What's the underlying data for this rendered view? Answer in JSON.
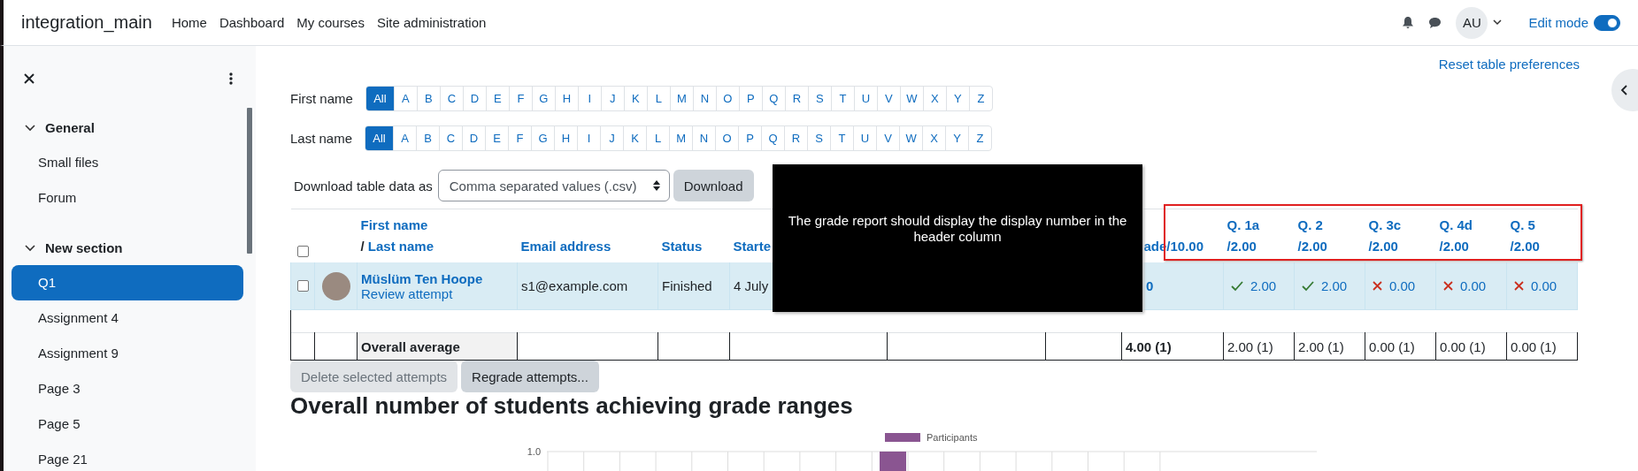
{
  "navbar": {
    "site_name": "integration_main",
    "links": [
      "Home",
      "Dashboard",
      "My courses",
      "Site administration"
    ],
    "avatar": "AU",
    "edit_mode": {
      "label": "Edit mode",
      "on": true
    }
  },
  "sidebar": {
    "sections": [
      {
        "title": "General",
        "expanded": true,
        "items": [
          {
            "label": "Small files",
            "selected": false
          },
          {
            "label": "Forum",
            "selected": false
          }
        ]
      },
      {
        "title": "New section",
        "expanded": true,
        "items": [
          {
            "label": "Q1",
            "selected": true
          },
          {
            "label": "Assignment 4",
            "selected": false
          },
          {
            "label": "Assignment 9",
            "selected": false
          },
          {
            "label": "Page 3",
            "selected": false
          },
          {
            "label": "Page 5",
            "selected": false
          },
          {
            "label": "Page 21",
            "selected": false
          }
        ]
      }
    ]
  },
  "reset_link": "Reset table preferences",
  "filters": [
    {
      "label": "First name",
      "letters": [
        {
          "label": "All",
          "selected": true
        },
        {
          "label": "A",
          "selected": false
        },
        {
          "label": "B",
          "selected": false
        },
        {
          "label": "C",
          "selected": false
        },
        {
          "label": "D",
          "selected": false
        },
        {
          "label": "E",
          "selected": false
        },
        {
          "label": "F",
          "selected": false
        },
        {
          "label": "G",
          "selected": false
        },
        {
          "label": "H",
          "selected": false
        },
        {
          "label": "I",
          "selected": false
        },
        {
          "label": "J",
          "selected": false
        },
        {
          "label": "K",
          "selected": false
        },
        {
          "label": "L",
          "selected": false
        },
        {
          "label": "M",
          "selected": false
        },
        {
          "label": "N",
          "selected": false
        },
        {
          "label": "O",
          "selected": false
        },
        {
          "label": "P",
          "selected": false
        },
        {
          "label": "Q",
          "selected": false
        },
        {
          "label": "R",
          "selected": false
        },
        {
          "label": "S",
          "selected": false
        },
        {
          "label": "T",
          "selected": false
        },
        {
          "label": "U",
          "selected": false
        },
        {
          "label": "V",
          "selected": false
        },
        {
          "label": "W",
          "selected": false
        },
        {
          "label": "X",
          "selected": false
        },
        {
          "label": "Y",
          "selected": false
        },
        {
          "label": "Z",
          "selected": false
        }
      ]
    },
    {
      "label": "Last name",
      "letters": [
        {
          "label": "All",
          "selected": true
        },
        {
          "label": "A",
          "selected": false
        },
        {
          "label": "B",
          "selected": false
        },
        {
          "label": "C",
          "selected": false
        },
        {
          "label": "D",
          "selected": false
        },
        {
          "label": "E",
          "selected": false
        },
        {
          "label": "F",
          "selected": false
        },
        {
          "label": "G",
          "selected": false
        },
        {
          "label": "H",
          "selected": false
        },
        {
          "label": "I",
          "selected": false
        },
        {
          "label": "J",
          "selected": false
        },
        {
          "label": "K",
          "selected": false
        },
        {
          "label": "L",
          "selected": false
        },
        {
          "label": "M",
          "selected": false
        },
        {
          "label": "N",
          "selected": false
        },
        {
          "label": "O",
          "selected": false
        },
        {
          "label": "P",
          "selected": false
        },
        {
          "label": "Q",
          "selected": false
        },
        {
          "label": "R",
          "selected": false
        },
        {
          "label": "S",
          "selected": false
        },
        {
          "label": "T",
          "selected": false
        },
        {
          "label": "U",
          "selected": false
        },
        {
          "label": "V",
          "selected": false
        },
        {
          "label": "W",
          "selected": false
        },
        {
          "label": "X",
          "selected": false
        },
        {
          "label": "Y",
          "selected": false
        },
        {
          "label": "Z",
          "selected": false
        }
      ]
    }
  ],
  "download": {
    "label": "Download table data as",
    "format": "Comma separated values (.csv)",
    "button": "Download"
  },
  "table": {
    "select_all_checked": false,
    "header": {
      "first_name": "First name",
      "separator": "/",
      "last_name": "Last name",
      "email": "Email address",
      "status": "Status",
      "started": "Starte",
      "grade": "ade/10.00"
    },
    "questions": [
      {
        "label": "Q. 1a",
        "max": "/2.00"
      },
      {
        "label": "Q. 2",
        "max": "/2.00"
      },
      {
        "label": "Q. 3c",
        "max": "/2.00"
      },
      {
        "label": "Q. 4d",
        "max": "/2.00"
      },
      {
        "label": "Q. 5",
        "max": "/2.00"
      }
    ],
    "rows": [
      {
        "checked": false,
        "name": "Müslüm Ten Hoope",
        "review": "Review attempt",
        "email": "s1@example.com",
        "status": "Finished",
        "started": "4 July",
        "grade": "0",
        "answers": [
          {
            "kind": "correct",
            "score": "2.00"
          },
          {
            "kind": "correct",
            "score": "2.00"
          },
          {
            "kind": "incorrect",
            "score": "0.00"
          },
          {
            "kind": "incorrect",
            "score": "0.00"
          },
          {
            "kind": "incorrect",
            "score": "0.00"
          }
        ]
      }
    ],
    "average": {
      "label": "Overall average",
      "grade": "4.00 (1)",
      "questions": [
        "2.00 (1)",
        "2.00 (1)",
        "0.00 (1)",
        "0.00 (1)",
        "0.00 (1)"
      ]
    }
  },
  "annotation": {
    "note": "The grade report should display the display number in the header column"
  },
  "buttons": [
    {
      "label": "Delete selected attempts",
      "disabled": true
    },
    {
      "label": "Regrade attempts...",
      "disabled": false
    }
  ],
  "chart": {
    "heading": "Overall number of students achieving grade ranges",
    "legend": "Participants",
    "y_tick": "1.0"
  }
}
